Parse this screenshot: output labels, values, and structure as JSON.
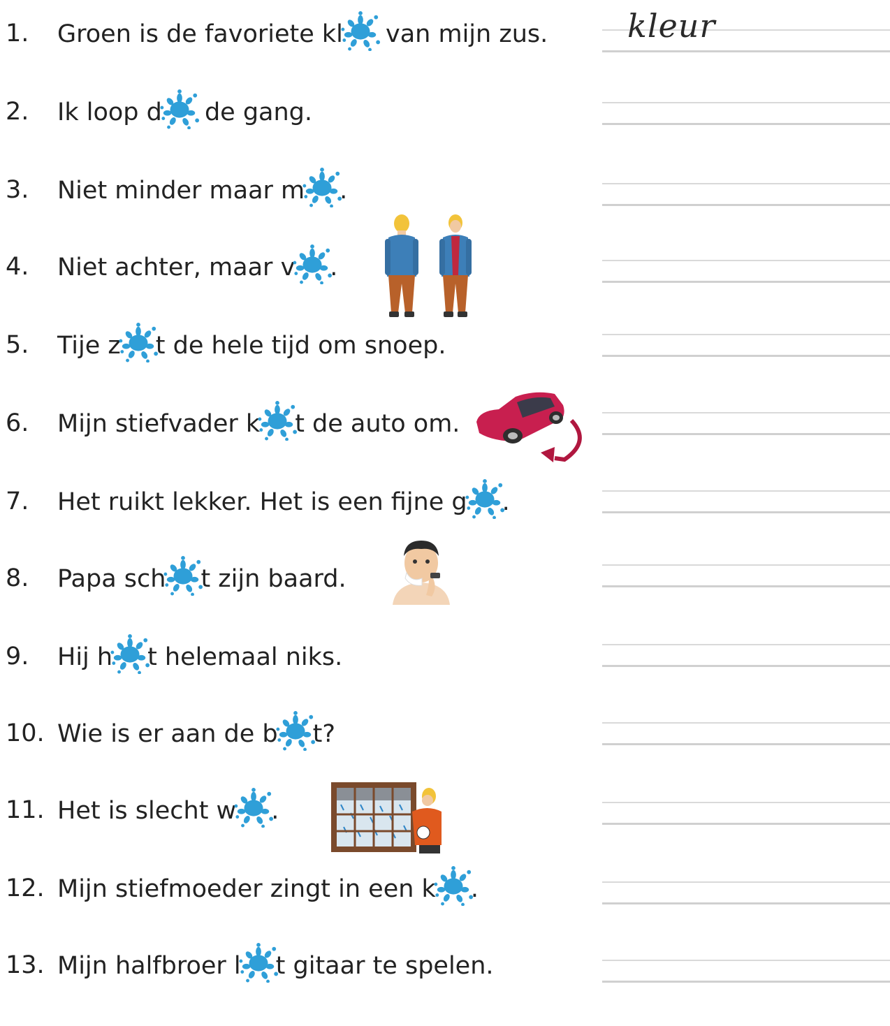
{
  "colors": {
    "splat": "#2f9fd8",
    "line": "#d6d6d6",
    "text": "#222222"
  },
  "items": [
    {
      "num": "1.",
      "before": "Groen is de favoriete kl",
      "after": " van mijn zus.",
      "answer": "kleur"
    },
    {
      "num": "2.",
      "before": "Ik loop d",
      "after": " de gang.",
      "answer": ""
    },
    {
      "num": "3.",
      "before": "Niet minder maar m",
      "after": ".",
      "answer": ""
    },
    {
      "num": "4.",
      "before": "Niet achter, maar v",
      "after": ".",
      "answer": ""
    },
    {
      "num": "5.",
      "before": "Tije z",
      "after": "t de hele tijd om snoep.",
      "answer": ""
    },
    {
      "num": "6.",
      "before": "Mijn stiefvader k",
      "after": "t de auto om.",
      "answer": ""
    },
    {
      "num": "7.",
      "before": "Het ruikt lekker. Het is een fijne g",
      "after": ".",
      "answer": ""
    },
    {
      "num": "8.",
      "before": "Papa sch",
      "after": "t zijn baard.",
      "answer": ""
    },
    {
      "num": "9.",
      "before": "Hij h",
      "after": "t helemaal niks.",
      "answer": ""
    },
    {
      "num": "10.",
      "before": "Wie is er aan de b",
      "after": "t?",
      "answer": ""
    },
    {
      "num": "11.",
      "before": "Het is slecht w",
      "after": ".",
      "answer": ""
    },
    {
      "num": "12.",
      "before": "Mijn stiefmoeder zingt in een k",
      "after": ".",
      "answer": ""
    },
    {
      "num": "13.",
      "before": "Mijn halfbroer l",
      "after": "t gitaar te spelen.",
      "answer": ""
    }
  ],
  "icons": {
    "splat": "ink-splat-icon",
    "two_men": "two-men-front-back-illustration",
    "car": "red-car-turning-illustration",
    "shaving": "man-shaving-illustration",
    "window": "man-at-rainy-window-illustration"
  }
}
